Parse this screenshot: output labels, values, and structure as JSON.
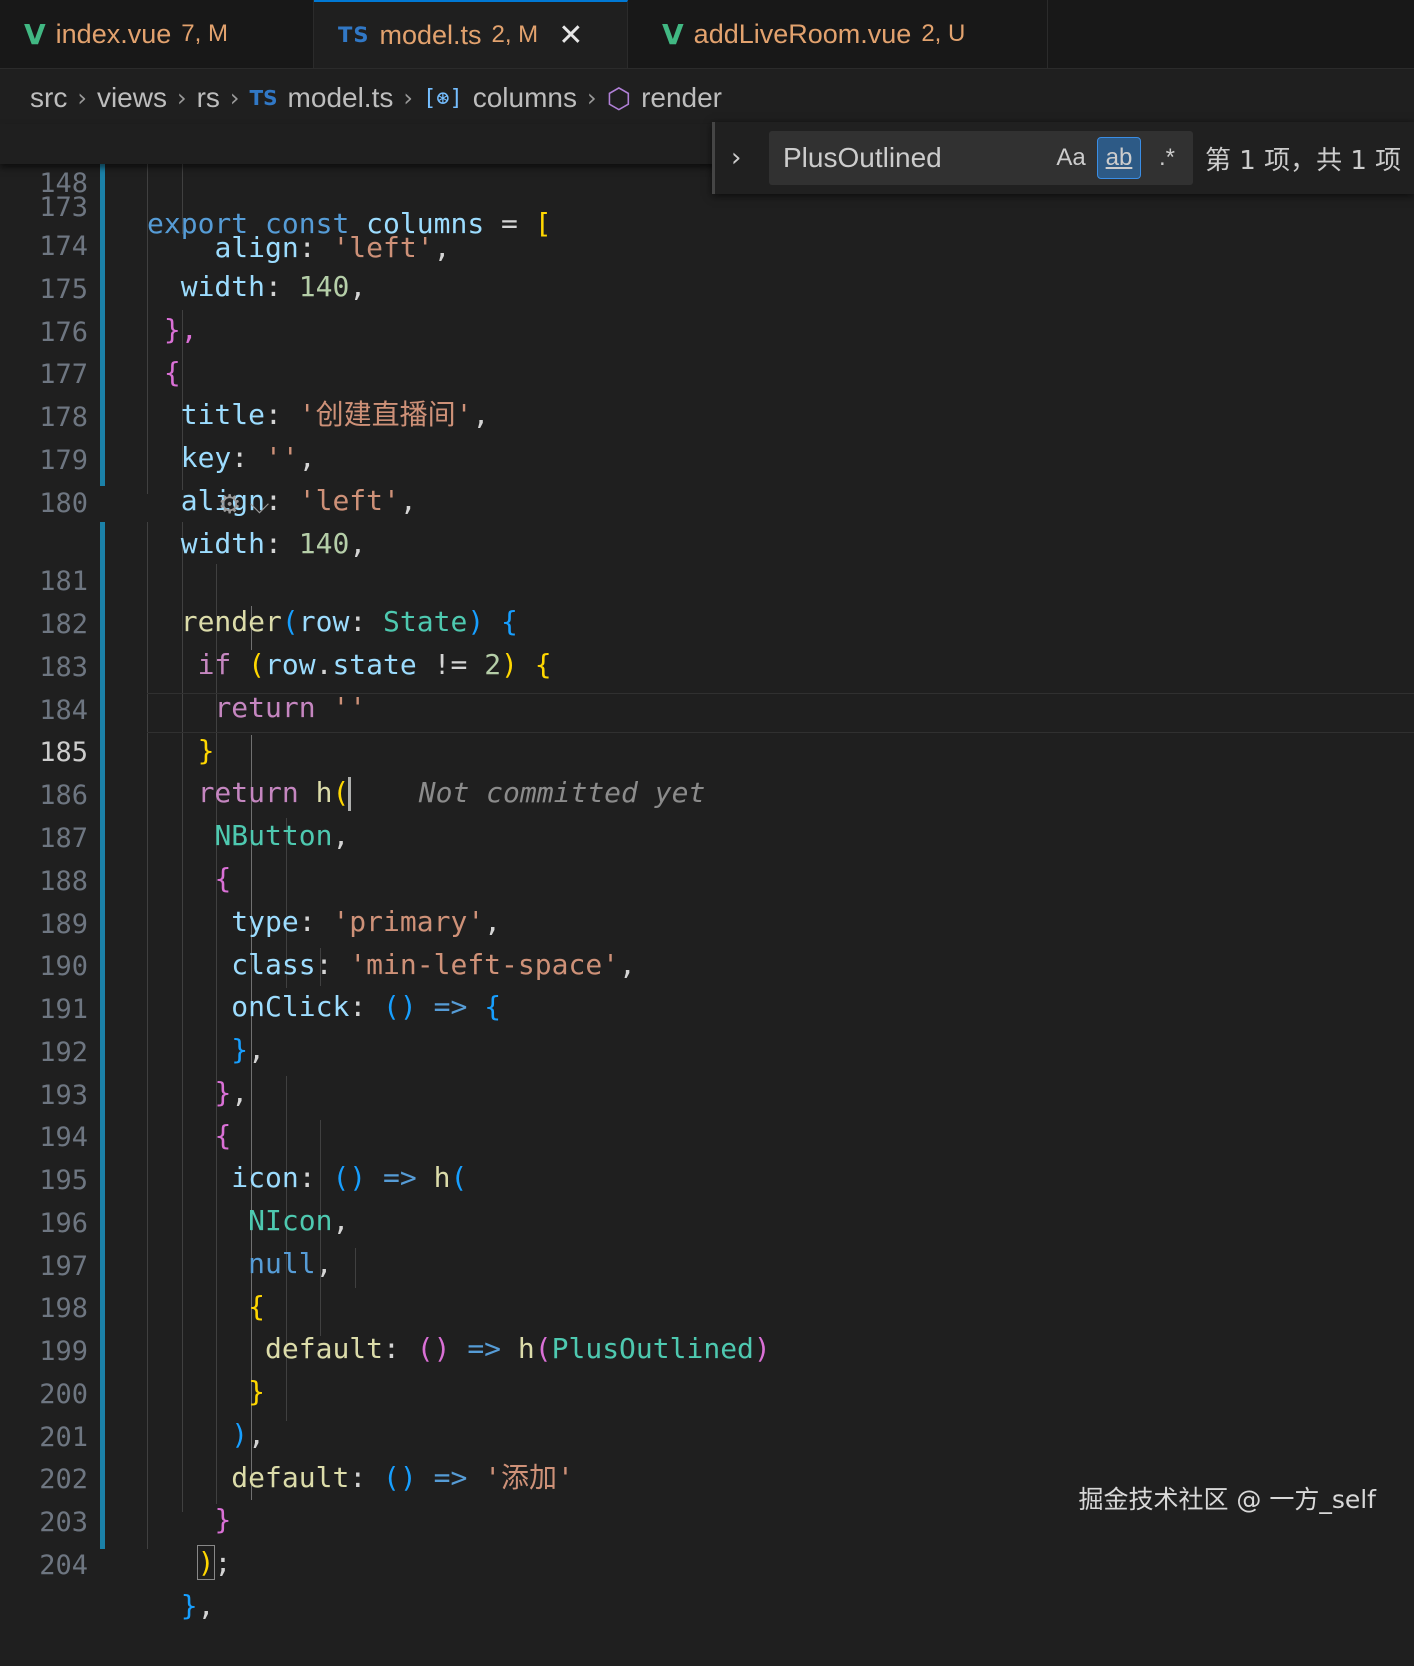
{
  "tabs": [
    {
      "name": "index.vue",
      "badge": "7, M"
    },
    {
      "name": "model.ts",
      "badge": "2, M"
    },
    {
      "name": "addLiveRoom.vue",
      "badge": "2, U"
    }
  ],
  "icons": {
    "vue": "V",
    "ts": "TS",
    "close": "✕",
    "chevron": "〉"
  },
  "breadcrumb": [
    "src",
    "views",
    "rs",
    "model.ts",
    "columns",
    "render"
  ],
  "find_widget": {
    "query": "PlusOutlined",
    "match_case": "Aa",
    "whole_word": "ab",
    "regex": ".*",
    "result": "第 1 项，共 1 项"
  },
  "codelens": "⚙ ⌵",
  "blame_hint": "Not committed yet",
  "current_line": "185",
  "watermark": "掘金技术社区 @ 一方_self",
  "code": {
    "sticky": {
      "ln": "148",
      "export": "export",
      "const": "const",
      "name": "columns",
      "eq": " = ",
      "br": "["
    },
    "l173": {
      "ln": "173"
    },
    "l174": {
      "ln": "174",
      "prop": "width",
      "num": "140"
    },
    "l175": {
      "ln": "175",
      "text": "},"
    },
    "l176": {
      "ln": "176",
      "text": "{"
    },
    "l177": {
      "ln": "177",
      "prop": "title",
      "str": "'创建直播间'"
    },
    "l178": {
      "ln": "178",
      "prop": "key",
      "str": "''"
    },
    "l179": {
      "ln": "179",
      "prop": "align",
      "str": "'left'"
    },
    "l180": {
      "ln": "180",
      "prop": "width",
      "num": "140"
    },
    "l181": {
      "ln": "181",
      "fn": "render",
      "param": "row",
      "type": "State"
    },
    "l182": {
      "ln": "182",
      "kw": "if",
      "obj": "row",
      "prop": "state",
      "op": " != ",
      "num": "2"
    },
    "l183": {
      "ln": "183",
      "kw": "return",
      "str": "''"
    },
    "l184": {
      "ln": "184",
      "text": "}"
    },
    "l185": {
      "ln": "185",
      "kw": "return",
      "fn": "h"
    },
    "l186": {
      "ln": "186",
      "type": "NButton"
    },
    "l187": {
      "ln": "187",
      "text": "{"
    },
    "l188": {
      "ln": "188",
      "prop": "type",
      "str": "'primary'"
    },
    "l189": {
      "ln": "189",
      "prop": "class",
      "str": "'min-left-space'"
    },
    "l190": {
      "ln": "190",
      "prop": "onClick",
      "arrow": "=>"
    },
    "l191": {
      "ln": "191",
      "text": "}"
    },
    "l192": {
      "ln": "192",
      "text": "}"
    },
    "l193": {
      "ln": "193",
      "text": "{"
    },
    "l194": {
      "ln": "194",
      "prop": "icon",
      "arrow": "=>",
      "fn": "h"
    },
    "l195": {
      "ln": "195",
      "type": "NIcon"
    },
    "l196": {
      "ln": "196",
      "kw": "null"
    },
    "l197": {
      "ln": "197",
      "text": "{"
    },
    "l198": {
      "ln": "198",
      "prop": "default",
      "arrow": "=>",
      "fn": "h",
      "arg": "PlusOutlined"
    },
    "l199": {
      "ln": "199",
      "text": "}"
    },
    "l200": {
      "ln": "200",
      "text": ")"
    },
    "l201": {
      "ln": "201",
      "prop": "default",
      "arrow": "=>",
      "str": "'添加'"
    },
    "l202": {
      "ln": "202",
      "text": "}"
    },
    "l203": {
      "ln": "203",
      "text": ")"
    },
    "l204": {
      "ln": "204",
      "text": "}"
    }
  }
}
